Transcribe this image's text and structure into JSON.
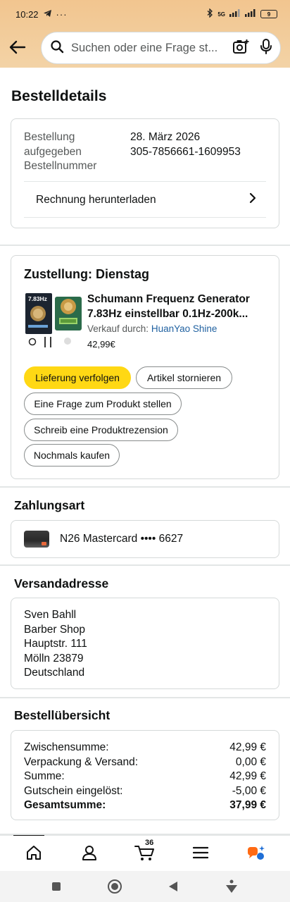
{
  "status_bar": {
    "time": "10:22",
    "signal_label": "5G",
    "battery_level": "9"
  },
  "header": {
    "search_placeholder": "Suchen oder eine Frage st..."
  },
  "page": {
    "title": "Bestelldetails"
  },
  "order": {
    "labels": [
      "Bestellung",
      "aufgegeben",
      "Bestellnummer"
    ],
    "date": "28. März 2026",
    "number": "305-7856661-1609953",
    "invoice_label": "Rechnung herunterladen"
  },
  "delivery": {
    "title": "Zustellung: Dienstag",
    "product": {
      "title_line1": "Schumann Frequenz Generator",
      "title_line2": "7.83Hz einstellbar 0.1Hz-200k...",
      "sold_by_label": "Verkauf durch:",
      "seller": "HuanYao Shine",
      "price": "42,99€",
      "image_text": "7.83Hz"
    },
    "buttons": {
      "track": "Lieferung verfolgen",
      "cancel": "Artikel stornieren",
      "question": "Eine Frage zum Produkt stellen",
      "review": "Schreib eine Produktrezension",
      "buy_again": "Nochmals kaufen"
    }
  },
  "payment": {
    "title": "Zahlungsart",
    "method": "N26 Mastercard •••• 6627"
  },
  "shipping": {
    "title": "Versandadresse",
    "lines": [
      "Sven Bahll",
      "Barber Shop",
      "Hauptstr. 111",
      "Mölln 23879",
      "Deutschland"
    ]
  },
  "summary": {
    "title": "Bestellübersicht",
    "rows": [
      {
        "label": "Zwischensumme:",
        "value": "42,99 €"
      },
      {
        "label": "Verpackung & Versand:",
        "value": "0,00 €"
      },
      {
        "label": "Summe:",
        "value": "42,99 €"
      },
      {
        "label": "Gutschein eingelöst:",
        "value": "-5,00 €"
      },
      {
        "label": "Gesamtsumme:",
        "value": "37,99 €"
      }
    ]
  },
  "bottom_nav": {
    "cart_count": "36",
    "icons": [
      "home-icon",
      "account-icon",
      "cart-icon",
      "menu-icon",
      "rufus-icon"
    ]
  },
  "colors": {
    "header_bg": "#f2c58f",
    "primary_button": "#ffd814",
    "link": "#2162a1"
  }
}
